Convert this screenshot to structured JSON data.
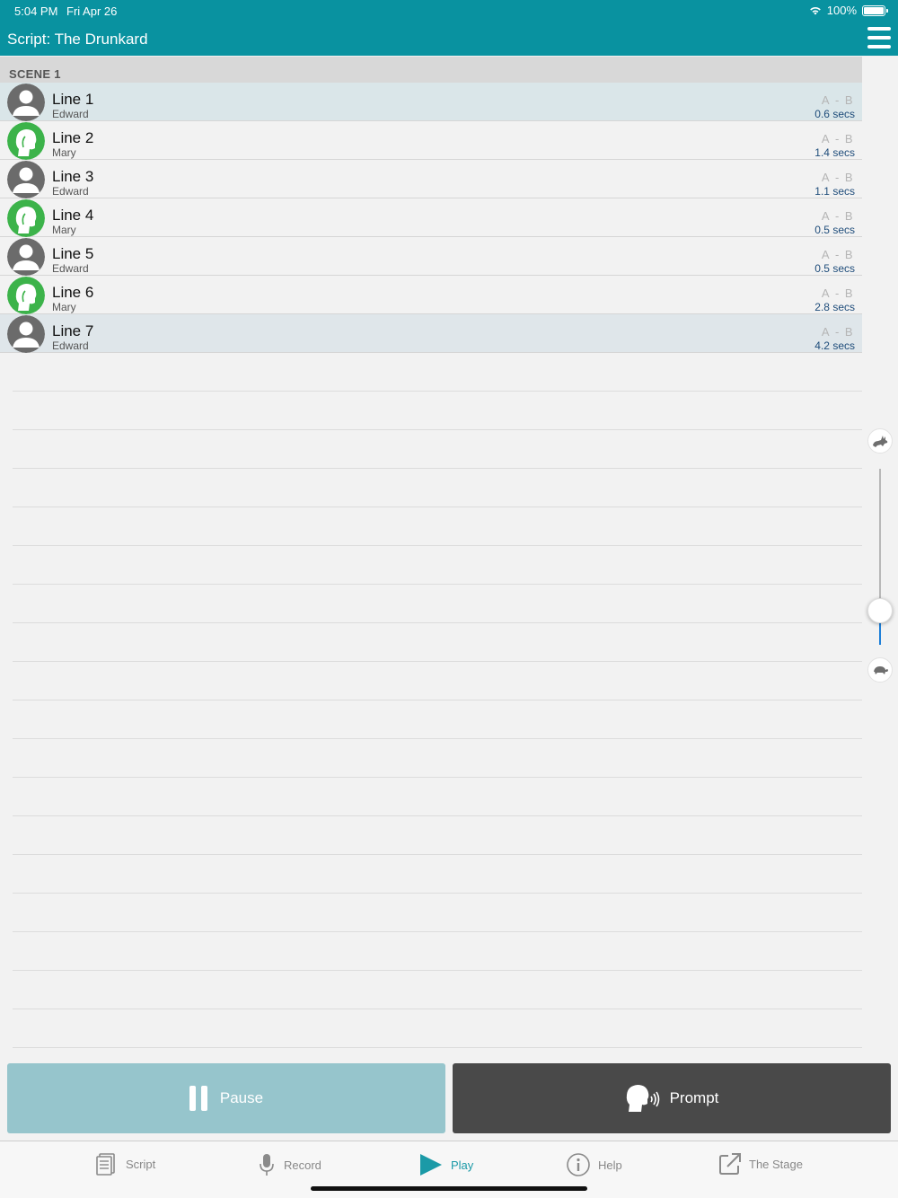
{
  "status_bar": {
    "time": "5:04 PM",
    "date": "Fri Apr 26",
    "battery": "100%"
  },
  "nav": {
    "title": "Script:  The Drunkard"
  },
  "scene": {
    "header": "SCENE 1"
  },
  "lines": [
    {
      "title": "Line 1",
      "actor": "Edward",
      "a": "A",
      "b": "B",
      "dash": "-",
      "secs": "0.6 secs"
    },
    {
      "title": "Line 2",
      "actor": "Mary",
      "a": "A",
      "b": "B",
      "dash": "-",
      "secs": "1.4 secs"
    },
    {
      "title": "Line 3",
      "actor": "Edward",
      "a": "A",
      "b": "B",
      "dash": "-",
      "secs": "1.1 secs"
    },
    {
      "title": "Line 4",
      "actor": "Mary",
      "a": "A",
      "b": "B",
      "dash": "-",
      "secs": "0.5 secs"
    },
    {
      "title": "Line 5",
      "actor": "Edward",
      "a": "A",
      "b": "B",
      "dash": "-",
      "secs": "0.5 secs"
    },
    {
      "title": "Line 6",
      "actor": "Mary",
      "a": "A",
      "b": "B",
      "dash": "-",
      "secs": "2.8 secs"
    },
    {
      "title": "Line 7",
      "actor": "Edward",
      "a": "A",
      "b": "B",
      "dash": "-",
      "secs": "4.2 secs"
    }
  ],
  "speed_slider": {
    "level_fraction": 0.2,
    "fast_icon": "rabbit-icon",
    "slow_icon": "turtle-icon"
  },
  "actions": {
    "pause_label": "Pause",
    "prompt_label": "Prompt"
  },
  "tabs": [
    {
      "label": "Script",
      "icon": "script-icon"
    },
    {
      "label": "Record",
      "icon": "microphone-icon"
    },
    {
      "label": "Play",
      "icon": "play-icon",
      "active": true
    },
    {
      "label": "Help",
      "icon": "info-icon"
    },
    {
      "label": "The Stage",
      "icon": "share-icon"
    }
  ],
  "colors": {
    "accent": "#0992a0",
    "edward_avatar": "#6b6b6b",
    "mary_avatar": "#3cb34a",
    "pause_bg": "#96c5cc",
    "prompt_bg": "#494949"
  }
}
